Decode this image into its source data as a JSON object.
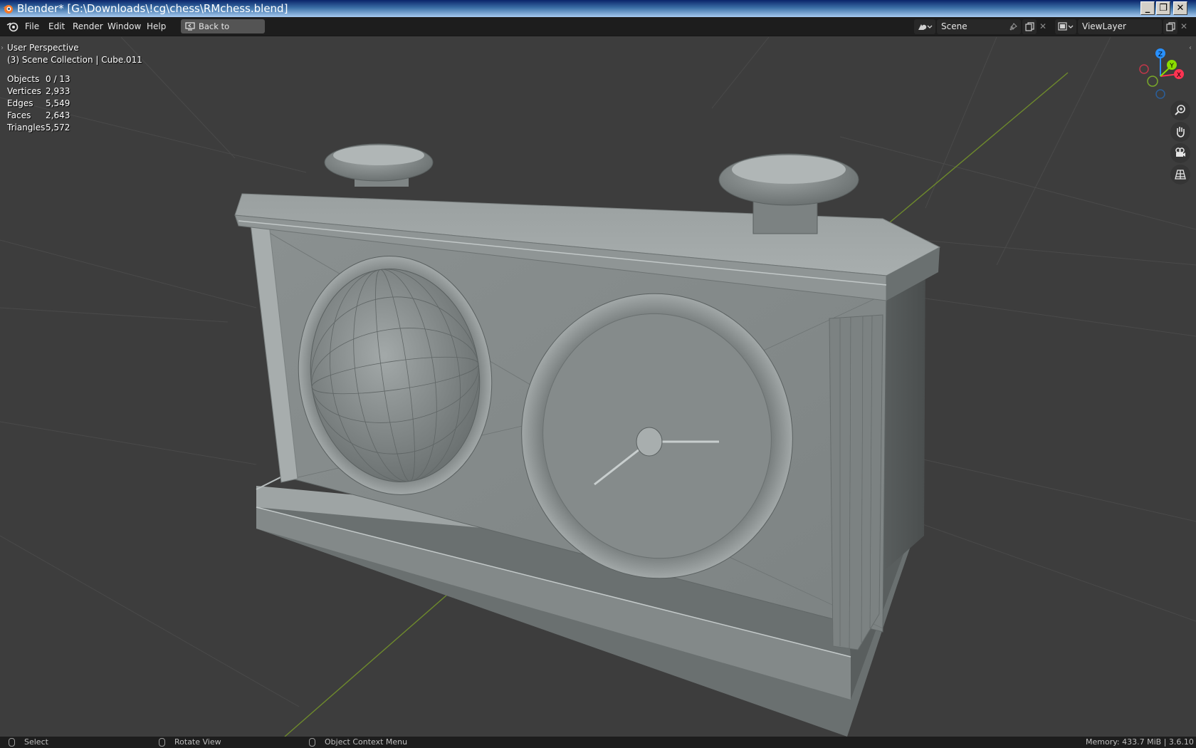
{
  "window": {
    "title": "Blender* [G:\\Downloads\\!cg\\chess\\RMchess.blend]",
    "controls": {
      "minimize": "_",
      "restore": "❐",
      "close": "✕"
    }
  },
  "topbar": {
    "menu": [
      "File",
      "Edit",
      "Render",
      "Window",
      "Help"
    ],
    "back_button": "Back to Previous",
    "scene_name": "Scene",
    "view_layer": "ViewLayer"
  },
  "viewport": {
    "perspective": "User Perspective",
    "collection": "(3) Scene Collection | Cube.011",
    "stats": [
      {
        "label": "Objects",
        "value": "0 / 13"
      },
      {
        "label": "Vertices",
        "value": "2,933"
      },
      {
        "label": "Edges",
        "value": "5,549"
      },
      {
        "label": "Faces",
        "value": "2,643"
      },
      {
        "label": "Triangles",
        "value": "5,572"
      }
    ],
    "gizmo": {
      "x": "X",
      "y": "Y",
      "z": "Z"
    },
    "nav_tools": [
      "zoom-icon",
      "hand-pan-icon",
      "camera-icon",
      "grid-perspective-icon"
    ]
  },
  "statusbar": {
    "select": "Select",
    "rotate": "Rotate View",
    "context": "Object Context Menu",
    "memory": "Memory: 433.7 MiB | 3.6.10"
  },
  "colors": {
    "viewport_bg": "#3d3d3d",
    "header_bg": "#1d1d1d",
    "axis_x": "#ff3352",
    "axis_y": "#8bdc00",
    "axis_z": "#2890ff",
    "model": "#8c9191"
  }
}
